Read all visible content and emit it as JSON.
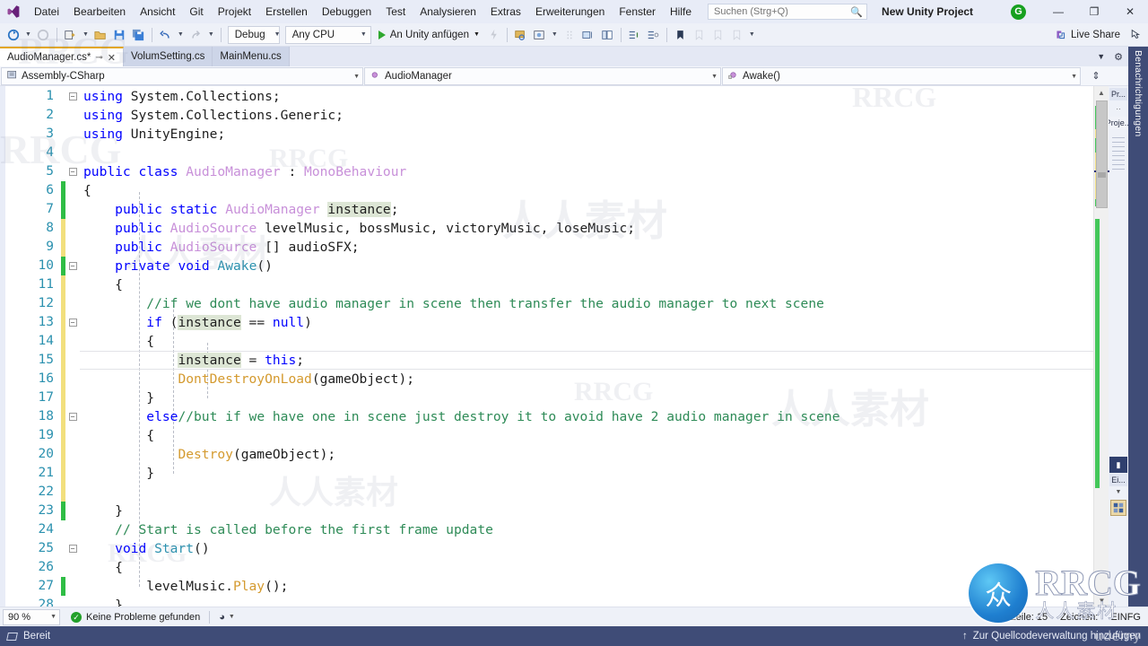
{
  "window": {
    "project_title": "New Unity Project",
    "account_initial": "G",
    "minimize": "—",
    "restore": "❐",
    "close": "✕"
  },
  "menubar": {
    "items": [
      "Datei",
      "Bearbeiten",
      "Ansicht",
      "Git",
      "Projekt",
      "Erstellen",
      "Debuggen",
      "Test",
      "Analysieren",
      "Extras",
      "Erweiterungen",
      "Fenster",
      "Hilfe"
    ]
  },
  "search": {
    "placeholder": "Suchen (Strg+Q)",
    "value": "",
    "icon": "search-icon"
  },
  "toolbar": {
    "config": "Debug",
    "platform": "Any CPU",
    "run_label": "An Unity anfügen",
    "live_share": "Live Share",
    "icons": [
      "navigate-backward-icon",
      "navigate-forward-icon",
      "new-project-icon",
      "open-file-icon",
      "save-icon",
      "save-all-icon",
      "undo-icon",
      "redo-icon"
    ]
  },
  "tabs": [
    {
      "label": "AudioManager.cs*",
      "active": true,
      "pinnable": true,
      "closable": true
    },
    {
      "label": "VolumSetting.cs",
      "active": false,
      "pinnable": false,
      "closable": false
    },
    {
      "label": "MainMenu.cs",
      "active": false,
      "pinnable": false,
      "closable": false
    }
  ],
  "navbar": {
    "project": "Assembly-CSharp",
    "type": "AudioManager",
    "member": "Awake()"
  },
  "right_rail": {
    "properties_tab": "Pr...",
    "project_tab": "Proje...",
    "props_tab2": "Ei...",
    "notifications": "Benachrichtigungen"
  },
  "statusbar": {
    "zoom": "90 %",
    "problems": "Keine Probleme gefunden",
    "line_label": "Zeile: 15",
    "char_label": "Zeichen:",
    "ins_label": "EINFG"
  },
  "taskbar": {
    "ready": "Bereit",
    "source_control": "Zur Quellcodeverwaltung hinzufügen"
  },
  "editor": {
    "current_line": 15,
    "first_line": 1,
    "last_line": 28,
    "colors": {
      "keyword": "#0000ff",
      "type": "#2b91af",
      "user_type": "#c890d9",
      "comment": "#2e8b57",
      "method": "#d49a2f",
      "plain": "#1e1e1e",
      "line_number": "#2b91af",
      "highlight": "#dde6d5",
      "change_added": "#2fbd45",
      "change_modified": "#f2df7d"
    },
    "lines": [
      {
        "n": 1,
        "fold": "minus",
        "change": "none",
        "tokens": [
          {
            "t": "using",
            "c": "k"
          },
          {
            "t": " System.Collections;",
            "c": "pl"
          }
        ]
      },
      {
        "n": 2,
        "fold": "",
        "change": "none",
        "tokens": [
          {
            "t": "using",
            "c": "k"
          },
          {
            "t": " System.Collections.Generic;",
            "c": "pl"
          }
        ]
      },
      {
        "n": 3,
        "fold": "",
        "change": "none",
        "tokens": [
          {
            "t": "using",
            "c": "k"
          },
          {
            "t": " UnityEngine;",
            "c": "pl"
          }
        ]
      },
      {
        "n": 4,
        "fold": "",
        "change": "none",
        "tokens": []
      },
      {
        "n": 5,
        "fold": "minus",
        "change": "none",
        "tokens": [
          {
            "t": "public",
            "c": "k"
          },
          {
            "t": " ",
            "c": "pl"
          },
          {
            "t": "class",
            "c": "k"
          },
          {
            "t": " ",
            "c": "pl"
          },
          {
            "t": "AudioManager",
            "c": "ci"
          },
          {
            "t": " : ",
            "c": "pl"
          },
          {
            "t": "MonoBehaviour",
            "c": "ci"
          }
        ]
      },
      {
        "n": 6,
        "fold": "",
        "change": "added",
        "tokens": [
          {
            "t": "{",
            "c": "pl"
          }
        ]
      },
      {
        "n": 7,
        "fold": "",
        "change": "added",
        "tokens": [
          {
            "t": "    ",
            "c": "pl"
          },
          {
            "t": "public",
            "c": "k"
          },
          {
            "t": " ",
            "c": "pl"
          },
          {
            "t": "static",
            "c": "k"
          },
          {
            "t": " ",
            "c": "pl"
          },
          {
            "t": "AudioManager",
            "c": "ci"
          },
          {
            "t": " ",
            "c": "pl"
          },
          {
            "t": "instance",
            "c": "pl hl"
          },
          {
            "t": ";",
            "c": "pl"
          }
        ]
      },
      {
        "n": 8,
        "fold": "",
        "change": "modified",
        "tokens": [
          {
            "t": "    ",
            "c": "pl"
          },
          {
            "t": "public",
            "c": "k"
          },
          {
            "t": " ",
            "c": "pl"
          },
          {
            "t": "AudioSource",
            "c": "ci"
          },
          {
            "t": " levelMusic, bossMusic, victoryMusic, loseMusic;",
            "c": "pl"
          }
        ]
      },
      {
        "n": 9,
        "fold": "",
        "change": "modified",
        "tokens": [
          {
            "t": "    ",
            "c": "pl"
          },
          {
            "t": "public",
            "c": "k"
          },
          {
            "t": " ",
            "c": "pl"
          },
          {
            "t": "AudioSource",
            "c": "ci"
          },
          {
            "t": " [] audioSFX;",
            "c": "pl"
          }
        ]
      },
      {
        "n": 10,
        "fold": "minus",
        "change": "added",
        "tokens": [
          {
            "t": "    ",
            "c": "pl"
          },
          {
            "t": "private",
            "c": "k"
          },
          {
            "t": " ",
            "c": "pl"
          },
          {
            "t": "void",
            "c": "k"
          },
          {
            "t": " ",
            "c": "pl"
          },
          {
            "t": "Awake",
            "c": "ty"
          },
          {
            "t": "()",
            "c": "pl"
          }
        ]
      },
      {
        "n": 11,
        "fold": "",
        "change": "modified",
        "tokens": [
          {
            "t": "    {",
            "c": "pl"
          }
        ]
      },
      {
        "n": 12,
        "fold": "",
        "change": "modified",
        "tokens": [
          {
            "t": "        ",
            "c": "pl"
          },
          {
            "t": "//if we dont have audio manager in scene then transfer the audio manager to next scene",
            "c": "cm"
          }
        ]
      },
      {
        "n": 13,
        "fold": "minus",
        "change": "modified",
        "tokens": [
          {
            "t": "        ",
            "c": "pl"
          },
          {
            "t": "if",
            "c": "k"
          },
          {
            "t": " (",
            "c": "pl"
          },
          {
            "t": "instance",
            "c": "pl hl"
          },
          {
            "t": " == ",
            "c": "pl"
          },
          {
            "t": "null",
            "c": "k"
          },
          {
            "t": ")",
            "c": "pl"
          }
        ]
      },
      {
        "n": 14,
        "fold": "",
        "change": "modified",
        "tokens": [
          {
            "t": "        {",
            "c": "pl"
          }
        ]
      },
      {
        "n": 15,
        "fold": "",
        "change": "modified",
        "tokens": [
          {
            "t": "            ",
            "c": "pl"
          },
          {
            "t": "instance",
            "c": "pl hl"
          },
          {
            "t": " = ",
            "c": "pl"
          },
          {
            "t": "this",
            "c": "k"
          },
          {
            "t": ";",
            "c": "pl"
          }
        ]
      },
      {
        "n": 16,
        "fold": "",
        "change": "modified",
        "tokens": [
          {
            "t": "            ",
            "c": "pl"
          },
          {
            "t": "DontDestroyOnLoad",
            "c": "mt"
          },
          {
            "t": "(gameObject);",
            "c": "pl"
          }
        ]
      },
      {
        "n": 17,
        "fold": "",
        "change": "modified",
        "tokens": [
          {
            "t": "        }",
            "c": "pl"
          }
        ]
      },
      {
        "n": 18,
        "fold": "minus",
        "change": "modified",
        "tokens": [
          {
            "t": "        ",
            "c": "pl"
          },
          {
            "t": "else",
            "c": "k"
          },
          {
            "t": "//but if we have one in scene just destroy it to avoid have 2 audio manager in scene",
            "c": "cm"
          }
        ]
      },
      {
        "n": 19,
        "fold": "",
        "change": "modified",
        "tokens": [
          {
            "t": "        {",
            "c": "pl"
          }
        ]
      },
      {
        "n": 20,
        "fold": "",
        "change": "modified",
        "tokens": [
          {
            "t": "            ",
            "c": "pl"
          },
          {
            "t": "Destroy",
            "c": "mt"
          },
          {
            "t": "(gameObject);",
            "c": "pl"
          }
        ]
      },
      {
        "n": 21,
        "fold": "",
        "change": "modified",
        "tokens": [
          {
            "t": "        }",
            "c": "pl"
          }
        ]
      },
      {
        "n": 22,
        "fold": "",
        "change": "modified",
        "tokens": []
      },
      {
        "n": 23,
        "fold": "",
        "change": "added",
        "tokens": [
          {
            "t": "    }",
            "c": "pl"
          }
        ]
      },
      {
        "n": 24,
        "fold": "",
        "change": "none",
        "tokens": [
          {
            "t": "    ",
            "c": "pl"
          },
          {
            "t": "// Start is called before the first frame update",
            "c": "cm"
          }
        ]
      },
      {
        "n": 25,
        "fold": "minus",
        "change": "none",
        "tokens": [
          {
            "t": "    ",
            "c": "pl"
          },
          {
            "t": "void",
            "c": "k"
          },
          {
            "t": " ",
            "c": "pl"
          },
          {
            "t": "Start",
            "c": "ty"
          },
          {
            "t": "()",
            "c": "pl"
          }
        ]
      },
      {
        "n": 26,
        "fold": "",
        "change": "none",
        "tokens": [
          {
            "t": "    {",
            "c": "pl"
          }
        ]
      },
      {
        "n": 27,
        "fold": "",
        "change": "added",
        "tokens": [
          {
            "t": "        ",
            "c": "pl"
          },
          {
            "t": "levelMusic.",
            "c": "pl"
          },
          {
            "t": "Play",
            "c": "mt"
          },
          {
            "t": "();",
            "c": "pl"
          }
        ]
      },
      {
        "n": 28,
        "fold": "",
        "change": "none",
        "tokens": [
          {
            "t": "    }",
            "c": "pl"
          }
        ]
      }
    ]
  },
  "watermarks": {
    "rrcg": "RRCG",
    "cjk": "人人素材",
    "logo_cjk": "人人素材",
    "logo_glyph": "众",
    "udemy": "udemy"
  }
}
